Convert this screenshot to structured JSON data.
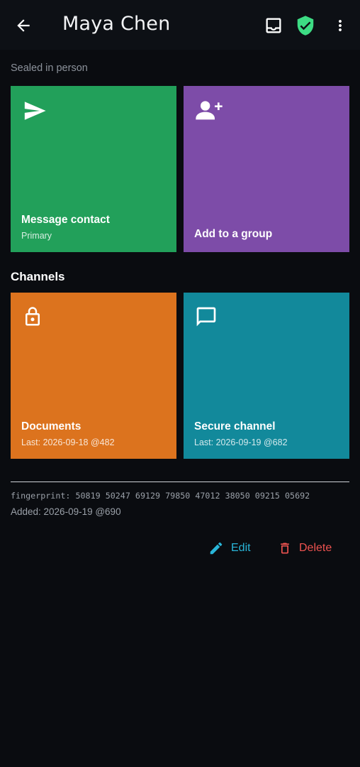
{
  "appbar": {
    "title": "Maya Chen",
    "icons": [
      "arrow-back-icon",
      "inbox-icon",
      "shield-check-icon",
      "more-vert-icon"
    ],
    "shield_color": "#3ddc84"
  },
  "caption": "Sealed in person",
  "tiles_top": [
    {
      "label": "Message contact",
      "sub": "Primary",
      "icon": "send-icon",
      "color": "#22a05a"
    },
    {
      "label": "Add to a group",
      "icon": "person-add-icon",
      "color": "#7d4ca8"
    }
  ],
  "channels_heading": "Channels",
  "channels": [
    {
      "label": "Documents",
      "sub": "Last: 2026-09-18 @482",
      "icon": "lock-icon",
      "color": "#dc731e"
    },
    {
      "label": "Secure channel",
      "sub": "Last: 2026-09-19 @682",
      "icon": "chat-bubble-icon",
      "color": "#12899b"
    }
  ],
  "fingerprint": "fingerprint: 50819 50247 69129 79850 47012 38050 09215 05692",
  "added": "Added: 2026-09-19  @690",
  "actions": {
    "edit_label": "Edit",
    "delete_label": "Delete",
    "edit_color": "#29b6d9",
    "delete_color": "#ef5350"
  }
}
